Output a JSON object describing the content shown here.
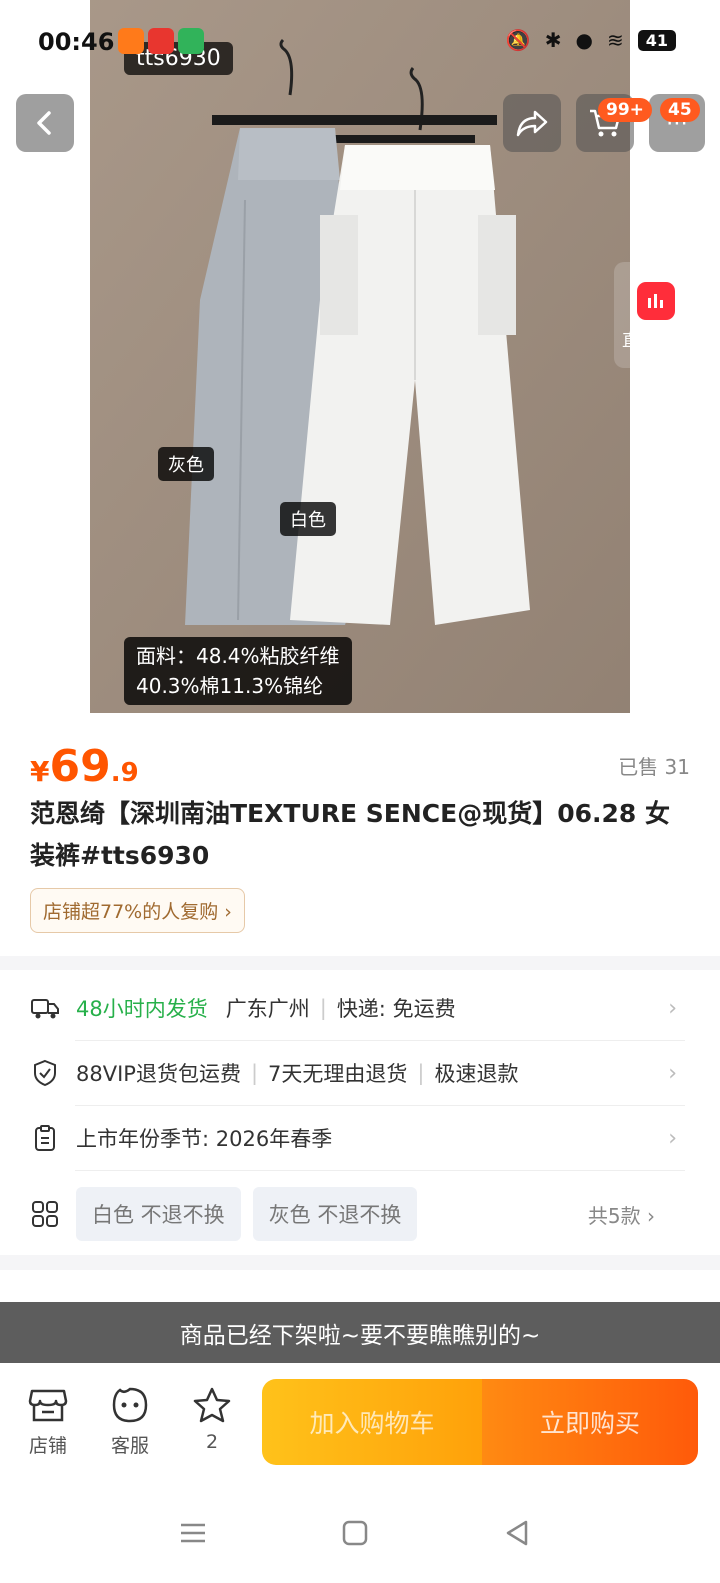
{
  "status_bar": {
    "time": "00:46",
    "battery": "41"
  },
  "hero": {
    "product_tag": "tts6930",
    "color_labels": {
      "gray": "灰色",
      "white": "白色"
    },
    "fabric_line1": "面料：48.4%粘胶纤维",
    "fabric_line2": "40.3%棉11.3%锦纶",
    "cart_badge": "99+",
    "more_badge": "45",
    "live_label": "直播讲解"
  },
  "product": {
    "price_symbol": "¥",
    "price_int": "69",
    "price_dec": ".9",
    "sold": "已售 31",
    "title": "范恩绮【深圳南油TEXTURE SENCE@现货】06.28 女装裤#tts6930",
    "repurchase": "店铺超77%的人复购 ›"
  },
  "services": {
    "shipping": {
      "speed": "48小时内发货",
      "location": "广东广州",
      "delivery": "快递: 免运费"
    },
    "returns": {
      "a": "88VIP退货包运费",
      "b": "7天无理由退货",
      "c": "极速退款"
    },
    "season": "上市年份季节: 2026年春季",
    "variants": [
      "白色 不退不换",
      "灰色 不退不换"
    ],
    "variant_total": "共5款 ›"
  },
  "toast": "商品已经下架啦~要不要瞧瞧别的~",
  "bottom_bar": {
    "shop": "店铺",
    "service": "客服",
    "favorites": "2",
    "add_to_cart": "加入购物车",
    "buy_now": "立即购买"
  }
}
